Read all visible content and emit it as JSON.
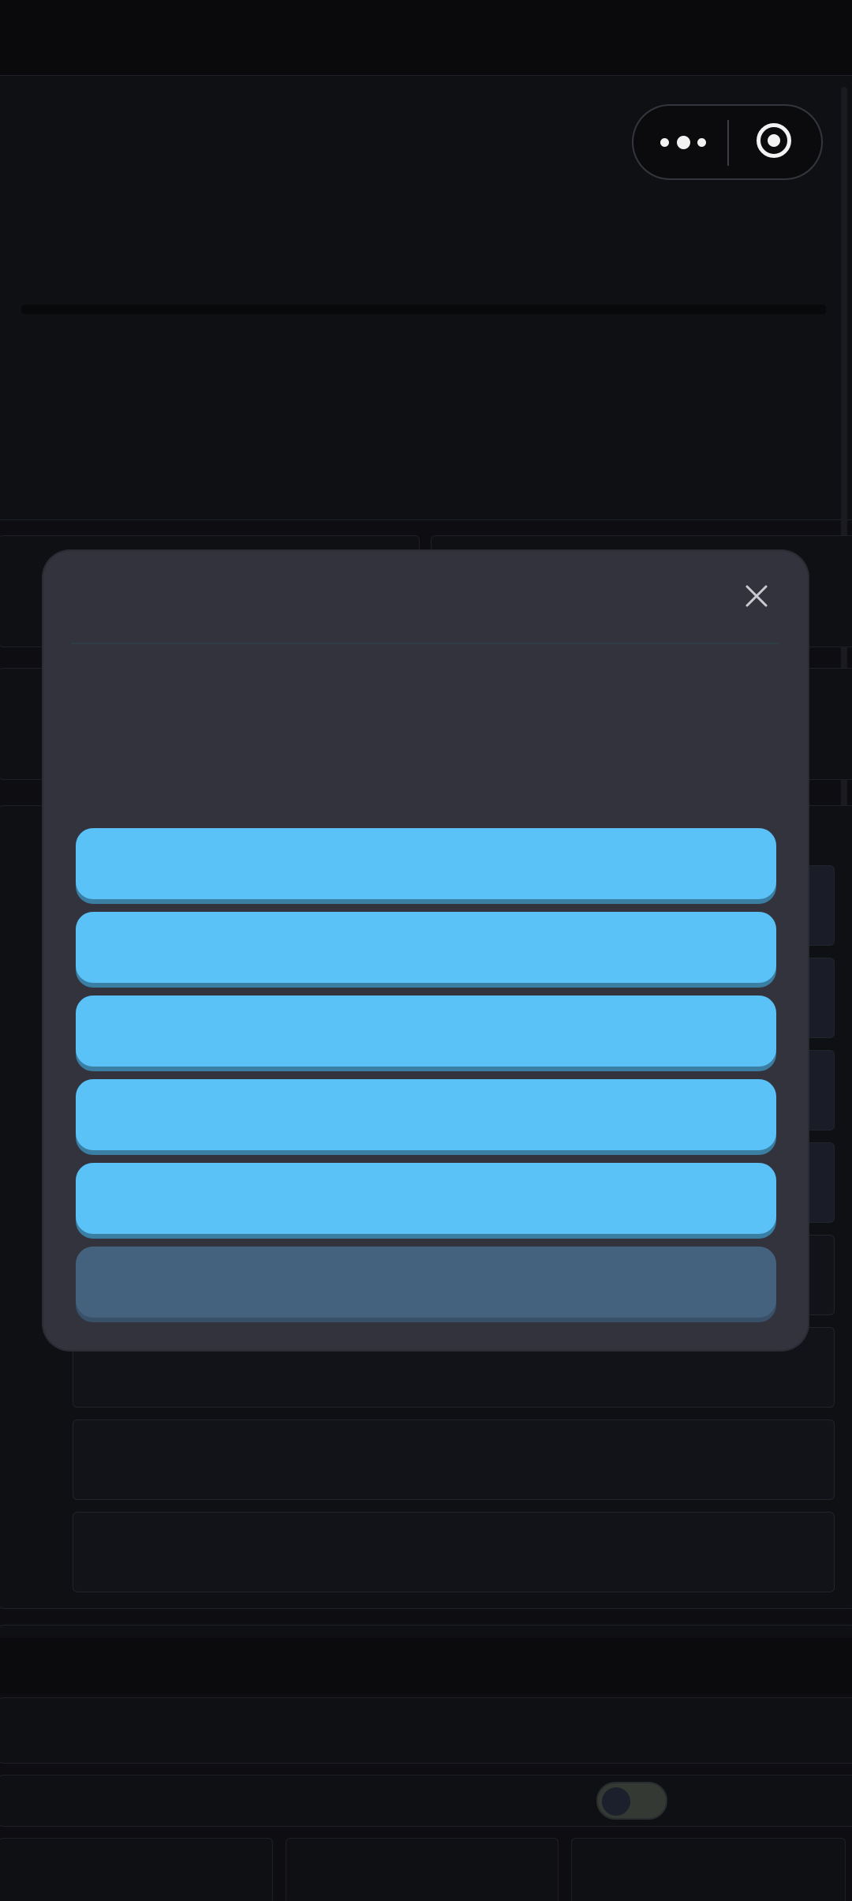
{
  "window": {
    "title": ""
  },
  "capsule": {
    "more_icon": "more-dots-icon",
    "close_icon": "target-close-icon"
  },
  "modal": {
    "title": "",
    "close_icon": "close-icon",
    "options": [
      {
        "label": ""
      },
      {
        "label": ""
      },
      {
        "label": ""
      },
      {
        "label": ""
      },
      {
        "label": ""
      },
      {
        "label": ""
      }
    ]
  },
  "settings": {
    "toggle_state": "off"
  },
  "colors": {
    "background": "#0e0e12",
    "modal": "#32333d",
    "option_button": "#5ac2f6",
    "option_button_disabled": "#44627e",
    "divider": "#2e3c46"
  }
}
